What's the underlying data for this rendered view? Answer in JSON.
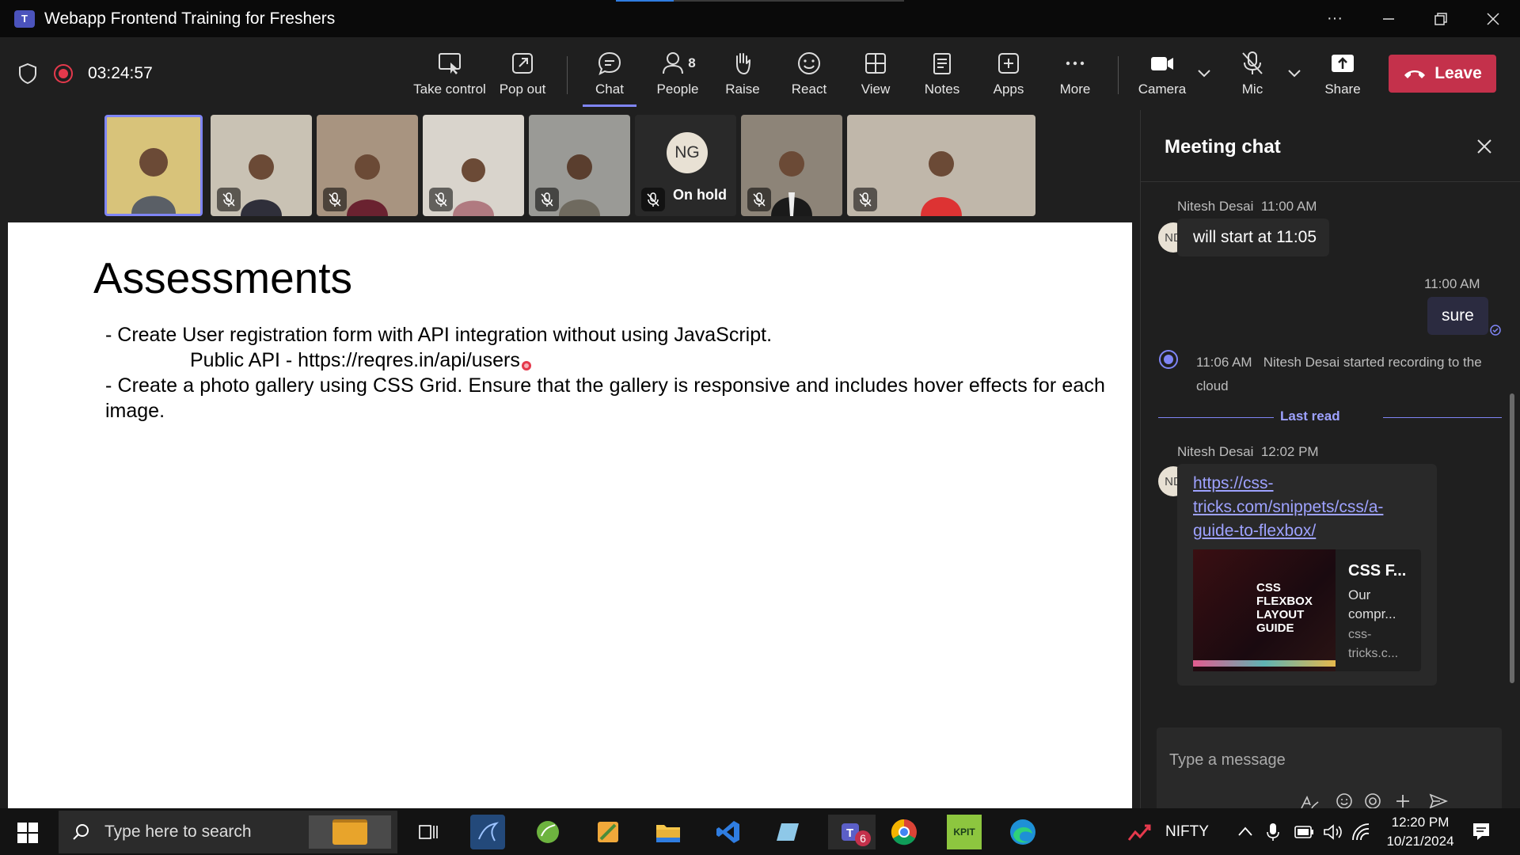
{
  "titlebar": {
    "title": "Webapp Frontend Training for Freshers",
    "app_icon": "teams-icon",
    "app_icon_text": "T",
    "more": "···"
  },
  "meeting": {
    "timer": "03:24:57"
  },
  "toolbar": {
    "take_control": "Take control",
    "pop_out": "Pop out",
    "chat": "Chat",
    "people": "People",
    "people_count": "8",
    "raise": "Raise",
    "react": "React",
    "view": "View",
    "notes": "Notes",
    "apps": "Apps",
    "more": "More",
    "camera": "Camera",
    "mic": "Mic",
    "share": "Share",
    "leave": "Leave"
  },
  "participants": [
    {
      "id": "p1",
      "muted": false,
      "active": true
    },
    {
      "id": "p2",
      "muted": true
    },
    {
      "id": "p3",
      "muted": true
    },
    {
      "id": "p4",
      "muted": true
    },
    {
      "id": "p5",
      "muted": true
    },
    {
      "id": "p6",
      "muted": true,
      "initials": "NG",
      "status": "On hold"
    },
    {
      "id": "p7",
      "muted": true
    },
    {
      "id": "p8",
      "muted": true
    }
  ],
  "slide": {
    "heading": "Assessments",
    "line1": "- Create User registration form with API integration without using JavaScript.",
    "line2_label": "Public API - ",
    "line2_url": "https://reqres.in/api/users",
    "line3": "- Create a photo gallery using CSS Grid. Ensure that the gallery is responsive and includes hover effects for each",
    "line4": "image."
  },
  "chat": {
    "header": "Meeting chat",
    "msg1_sender": "Nitesh Desai",
    "msg1_time": "11:00 AM",
    "msg1_avatar": "ND",
    "msg1_text": "will start at 11:05",
    "msg2_time": "11:00 AM",
    "msg2_text": "sure",
    "event_time": "11:06 AM",
    "event_text": "Nitesh Desai started recording to the cloud",
    "last_read": "Last read",
    "msg3_sender": "Nitesh Desai",
    "msg3_time": "12:02 PM",
    "msg3_avatar": "ND",
    "msg3_link_l1": "https://css-",
    "msg3_link_l2": "tricks.com/snippets/css/a-",
    "msg3_link_l3": "guide-to-flexbox/",
    "preview_image_text": "CSS FLEXBOX LAYOUT GUIDE",
    "preview_title": "CSS F...",
    "preview_desc1": "Our",
    "preview_desc2": "compr...",
    "preview_site1": "css-",
    "preview_site2": "tricks.c...",
    "compose_placeholder": "Type a message"
  },
  "taskbar": {
    "search_placeholder": "Type here to search",
    "teams_badge": "6",
    "kpit_label": "KPIT",
    "ticker": "NIFTY",
    "time": "12:20 PM",
    "date": "10/21/2024"
  },
  "colors": {
    "accent": "#7f85f5",
    "leave": "#c4314b",
    "record": "#e5394c"
  }
}
